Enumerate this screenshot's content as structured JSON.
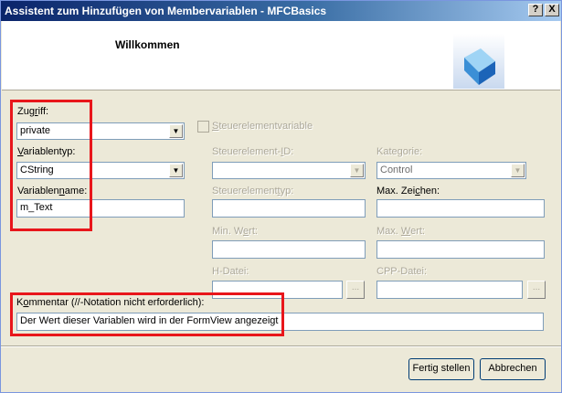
{
  "window": {
    "title": "Assistent zum Hinzufügen von Membervariablen - MFCBasics",
    "help_glyph": "?",
    "close_glyph": "X"
  },
  "header": {
    "title": "Willkommen",
    "logo_icon": "blue-cube-icon"
  },
  "access": {
    "label_pre": "Zug",
    "label_mn": "r",
    "label_post": "iff:",
    "value": "private"
  },
  "control_variable": {
    "checked": false,
    "label_mn": "S",
    "label_post": "teuerelementvariable"
  },
  "variable_type": {
    "label_mn": "V",
    "label_post": "ariablentyp:",
    "value": "CString"
  },
  "control_id": {
    "label_pre": "Steuerelement-",
    "label_mn": "I",
    "label_post": "D:",
    "value": ""
  },
  "category": {
    "label_pre": "Kategorie:",
    "value": "Control"
  },
  "variable_name": {
    "label_pre": "Variablen",
    "label_mn": "n",
    "label_post": "ame:",
    "value": "m_Text"
  },
  "control_type": {
    "label_pre": "Steuerelement",
    "label_mn": "t",
    "label_post": "yp:",
    "value": ""
  },
  "max_chars": {
    "label_pre": "Max. Zei",
    "label_mn": "c",
    "label_post": "hen:",
    "value": ""
  },
  "min_value": {
    "label_pre": "Min. W",
    "label_mn": "e",
    "label_post": "rt:",
    "value": ""
  },
  "max_value": {
    "label_pre": "Max. ",
    "label_mn": "W",
    "label_post": "ert:",
    "value": ""
  },
  "h_file": {
    "label_pre": "H-Datei:",
    "value": "",
    "browse_label": "..."
  },
  "cpp_file": {
    "label_pre": "CPP-Datei:",
    "value": "",
    "browse_label": "..."
  },
  "comment": {
    "label_pre": "K",
    "label_mn": "o",
    "label_post": "mmentar (//-Notation nicht erforderlich):",
    "value": "Der Wert dieser Variablen wird in der FormView angezeigt"
  },
  "buttons": {
    "finish": "Fertig stellen",
    "cancel": "Abbrechen"
  },
  "colors": {
    "highlight": "#e8161b",
    "title_gradient_start": "#0a246a",
    "dialog_bg": "#ece9d8"
  }
}
